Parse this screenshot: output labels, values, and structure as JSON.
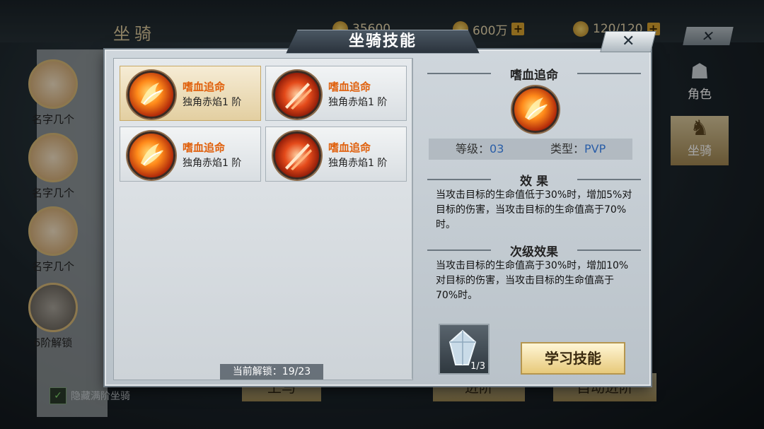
{
  "background": {
    "title": "坐骑",
    "resources": [
      {
        "icon": "gold-coin-icon",
        "value": "35600"
      },
      {
        "icon": "ingot-icon",
        "value": "600万"
      },
      {
        "icon": "stamina-icon",
        "value": "120/120"
      }
    ],
    "close_label": "✕",
    "mount_list": [
      {
        "label": "名字几个"
      },
      {
        "label": "名字几个"
      },
      {
        "label": "名字几个"
      },
      {
        "label": "6阶解锁"
      }
    ],
    "side_tabs": [
      {
        "label": "角色",
        "icon": "character-icon"
      },
      {
        "label": "坐骑",
        "icon": "horse-icon"
      }
    ],
    "hide_checkbox_label": "隐藏满阶坐骑",
    "bottom_buttons": [
      "上马",
      "进阶",
      "自动进阶"
    ]
  },
  "modal": {
    "title": "坐骑技能",
    "close_label": "✕",
    "skills": [
      {
        "name": "嗜血追命",
        "sub": "独角赤焰1 阶",
        "icon": "fire-claw-icon",
        "selected": true
      },
      {
        "name": "嗜血追命",
        "sub": "独角赤焰1 阶",
        "icon": "blade-slash-icon",
        "selected": false
      },
      {
        "name": "嗜血追命",
        "sub": "独角赤焰1 阶",
        "icon": "fire-claw-icon",
        "selected": false
      },
      {
        "name": "嗜血追命",
        "sub": "独角赤焰1 阶",
        "icon": "blade-slash-icon",
        "selected": false
      }
    ],
    "unlock_text": "当前解锁：19/23",
    "detail": {
      "name": "嗜血追命",
      "level_label": "等级：",
      "level_value": "03",
      "type_label": "类型：",
      "type_value": "PVP",
      "effect_title": "效 果",
      "effect_text": "当攻击目标的生命值低于30%时，增加5%对目标的伤害，当攻击目标的生命值高于70%时。",
      "secondary_title": "次级效果",
      "secondary_text": "当攻击目标的生命值高于30%时，增加10%对目标的伤害，当攻击目标的生命值高于70%时。",
      "item_count": "1/3",
      "learn_button": "学习技能"
    }
  },
  "colors": {
    "skill_name": "#e0600c",
    "stat_value": "#2a5ea8",
    "accent_gold": "#e7c97a"
  }
}
